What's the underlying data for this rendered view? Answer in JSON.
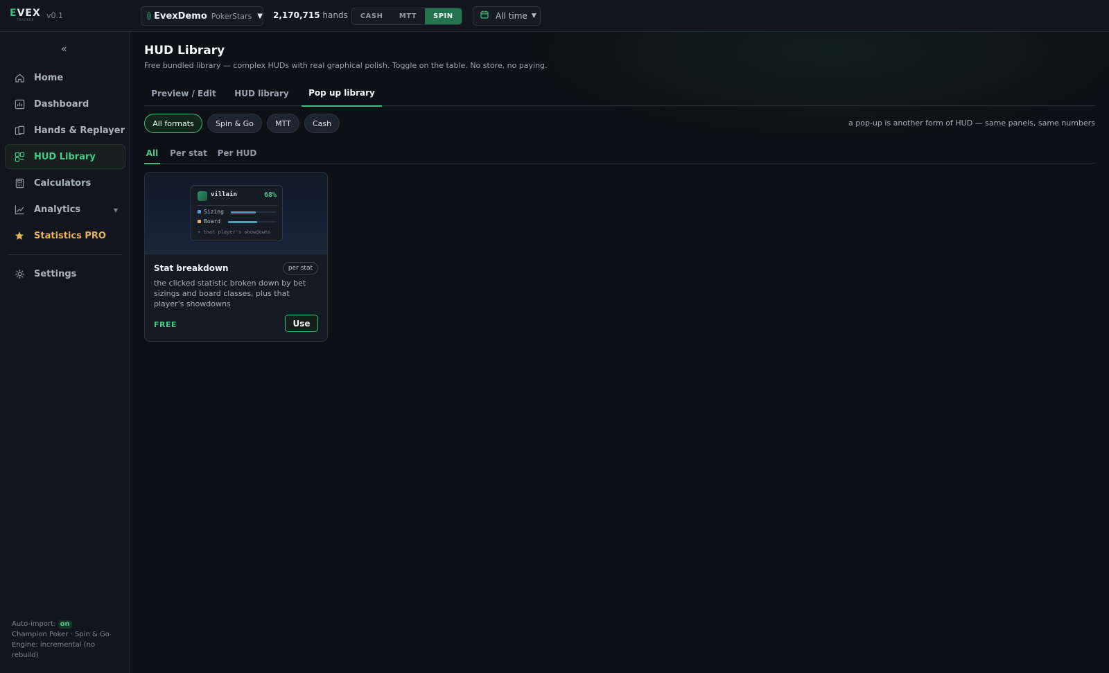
{
  "app": {
    "logo_text": "EVEX",
    "logo_sub": "TRACKER",
    "version": "v0.1"
  },
  "topbar": {
    "account_name": "EvexDemo",
    "account_site": "PokerStars",
    "hands_count": "2,170,715",
    "hands_label": "hands",
    "formats": [
      {
        "label": "CASH",
        "active": false
      },
      {
        "label": "MTT",
        "active": false
      },
      {
        "label": "SPIN",
        "active": true
      }
    ],
    "date_range": "All time"
  },
  "sidebar": {
    "collapse_label": "«",
    "items": [
      {
        "label": "Home",
        "icon": "home-icon"
      },
      {
        "label": "Dashboard",
        "icon": "dashboard-icon"
      },
      {
        "label": "Hands & Replayer",
        "icon": "cards-icon"
      },
      {
        "label": "HUD Library",
        "icon": "hud-icon",
        "active": true
      },
      {
        "label": "Calculators",
        "icon": "calculator-icon"
      },
      {
        "label": "Analytics",
        "icon": "chart-line-icon",
        "has_caret": true
      },
      {
        "label": "Statistics PRO",
        "icon": "star-icon"
      },
      {
        "label": "Settings",
        "icon": "gear-icon"
      }
    ],
    "footer": {
      "auto_import_label": "Auto-import:",
      "auto_import_status": "on",
      "site_line": "Champion Poker · Spin & Go",
      "engine_line": "Engine: incremental (no rebuild)"
    }
  },
  "main": {
    "title": "HUD Library",
    "subtitle": "Free bundled library — complex HUDs with real graphical polish. Toggle on the table. No store, no paying.",
    "tabs": [
      {
        "label": "Preview / Edit",
        "active": false
      },
      {
        "label": "HUD library",
        "active": false
      },
      {
        "label": "Pop up library",
        "active": true
      }
    ],
    "chips": [
      {
        "label": "All formats",
        "active": true
      },
      {
        "label": "Spin & Go",
        "active": false
      },
      {
        "label": "MTT",
        "active": false
      },
      {
        "label": "Cash",
        "active": false
      }
    ],
    "chip_note": "a pop-up is another form of HUD — same panels, same numbers",
    "subtabs": [
      {
        "label": "All",
        "active": true
      },
      {
        "label": "Per stat",
        "active": false
      },
      {
        "label": "Per HUD",
        "active": false
      }
    ],
    "cards": [
      {
        "preview": {
          "name": "villain",
          "pct": "68%",
          "rows": [
            {
              "label": "Sizing",
              "color": "#4a9fd8",
              "fill": 0.55
            },
            {
              "label": "Board",
              "color": "#e6b35a",
              "fill": 0.6
            }
          ],
          "footer": "+ that player's showdowns"
        },
        "title": "Stat breakdown",
        "tag": "per stat",
        "description": "the clicked statistic broken down by bet sizings and board classes, plus that player's showdowns",
        "price": "FREE",
        "button": "Use"
      }
    ]
  },
  "colors": {
    "accent": "#3fbf7f",
    "accent_text": "#46c98a",
    "pro": "#e6b35a",
    "background": "#0d1014",
    "panel": "#12161c"
  }
}
